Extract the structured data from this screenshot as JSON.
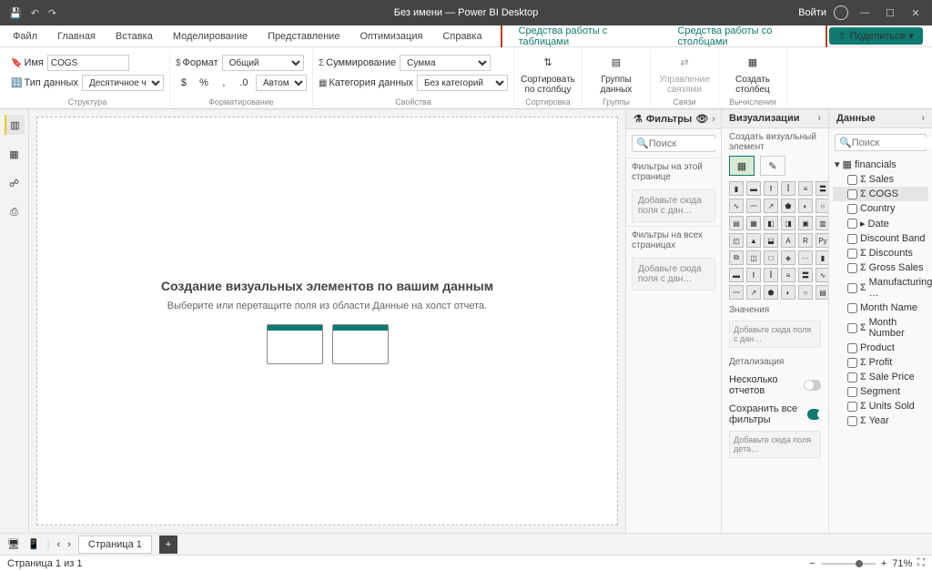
{
  "app": {
    "title": "Без имени — Power BI Desktop",
    "login": "Войти"
  },
  "tabs": {
    "file": "Файл",
    "home": "Главная",
    "insert": "Вставка",
    "model": "Моделирование",
    "view": "Представление",
    "optimize": "Оптимизация",
    "help": "Справка",
    "ctx_table": "Средства работы с таблицами",
    "ctx_column": "Средства работы со столбцами",
    "share": "Поделиться"
  },
  "ribbon": {
    "name_lbl": "Имя",
    "name_val": "COGS",
    "dtype_lbl": "Тип данных",
    "dtype_val": "Десятичное число",
    "group_struct": "Структура",
    "fmt_lbl": "Формат",
    "fmt_val": "Общий",
    "auto": "Автома…",
    "group_fmt": "Форматирование",
    "sum_lbl": "Суммирование",
    "sum_val": "Сумма",
    "cat_lbl": "Категория данных",
    "cat_val": "Без категорий",
    "group_props": "Свойства",
    "sort_col": "Сортировать по столбцу",
    "group_sort": "Сортировка",
    "groups": "Группы данных",
    "group_groups": "Группы",
    "relations": "Управление связями",
    "group_rel": "Связи",
    "new_col": "Создать столбец",
    "group_calc": "Вычисления"
  },
  "canvas": {
    "title": "Создание визуальных элементов по вашим данным",
    "sub": "Выберите или перетащите поля из области Данные на холст отчета."
  },
  "filters": {
    "title": "Фильтры",
    "search": "Поиск",
    "page": "Фильтры на этой странице",
    "all": "Фильтры на всех страницах",
    "drop": "Добавьте сюда поля с дан…"
  },
  "viz": {
    "title": "Визуализации",
    "sub": "Создать визуальный элемент",
    "values": "Значения",
    "drop1": "Добавьте сюда поля с дан…",
    "drill": "Детализация",
    "multi": "Несколько отчетов",
    "keepall": "Сохранить все фильтры",
    "drop2": "Добавьте сюда поля дета…"
  },
  "data": {
    "title": "Данные",
    "search": "Поиск",
    "table": "financials",
    "fields": [
      "Sales",
      "COGS",
      "Country",
      "Date",
      "Discount Band",
      "Discounts",
      "Gross Sales",
      "Manufacturing …",
      "Month Name",
      "Month Number",
      "Product",
      "Profit",
      "Sale Price",
      "Segment",
      "Units Sold",
      "Year"
    ]
  },
  "page": {
    "tab": "Страница 1",
    "status": "Страница 1 из 1",
    "zoom": "71%"
  }
}
